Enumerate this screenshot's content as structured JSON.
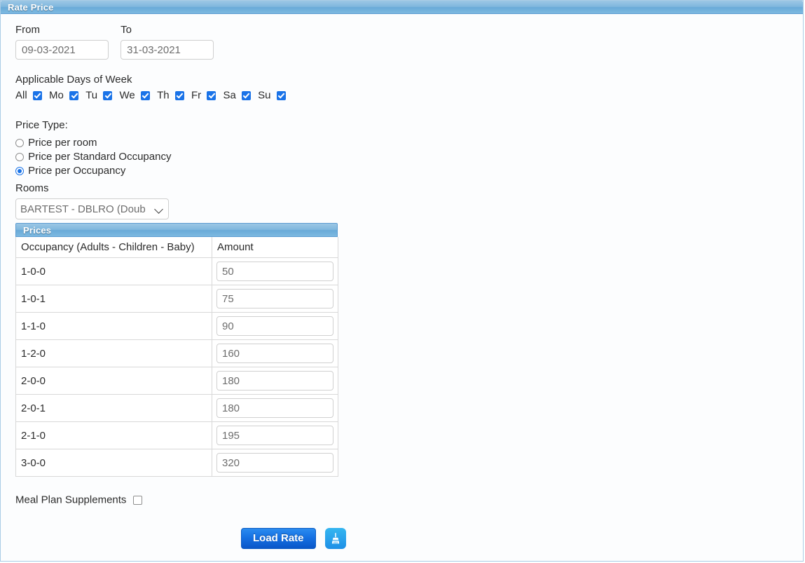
{
  "panel": {
    "title": "Rate Price"
  },
  "dates": {
    "from_label": "From",
    "from_value": "09-03-2021",
    "to_label": "To",
    "to_value": "31-03-2021"
  },
  "days": {
    "title": "Applicable Days of Week",
    "items": [
      {
        "label": "All",
        "checked": true
      },
      {
        "label": "Mo",
        "checked": true
      },
      {
        "label": "Tu",
        "checked": true
      },
      {
        "label": "We",
        "checked": true
      },
      {
        "label": "Th",
        "checked": true
      },
      {
        "label": "Fr",
        "checked": true
      },
      {
        "label": "Sa",
        "checked": true
      },
      {
        "label": "Su",
        "checked": true
      }
    ]
  },
  "price_type": {
    "title": "Price Type:",
    "options": [
      {
        "label": "Price per room",
        "selected": false
      },
      {
        "label": "Price per Standard Occupancy",
        "selected": false
      },
      {
        "label": "Price per Occupancy",
        "selected": true
      }
    ]
  },
  "rooms": {
    "label": "Rooms",
    "selected": "BARTEST - DBLRO (Doub"
  },
  "prices": {
    "title": "Prices",
    "columns": [
      "Occupancy (Adults - Children - Baby)",
      "Amount"
    ],
    "rows": [
      {
        "occupancy": "1-0-0",
        "amount": "50"
      },
      {
        "occupancy": "1-0-1",
        "amount": "75"
      },
      {
        "occupancy": "1-1-0",
        "amount": "90"
      },
      {
        "occupancy": "1-2-0",
        "amount": "160"
      },
      {
        "occupancy": "2-0-0",
        "amount": "180"
      },
      {
        "occupancy": "2-0-1",
        "amount": "180"
      },
      {
        "occupancy": "2-1-0",
        "amount": "195"
      },
      {
        "occupancy": "3-0-0",
        "amount": "320"
      }
    ]
  },
  "meal_plan": {
    "label": "Meal Plan Supplements",
    "checked": false
  },
  "actions": {
    "load_rate_label": "Load Rate",
    "clear_icon": "broom-icon"
  },
  "colors": {
    "titlebar_blue": "#7fb7dd",
    "accent_blue": "#1a73e8",
    "button_blue": "#1671e3",
    "clear_button_blue": "#2aa3ec",
    "panel_border": "#a9cce6"
  }
}
